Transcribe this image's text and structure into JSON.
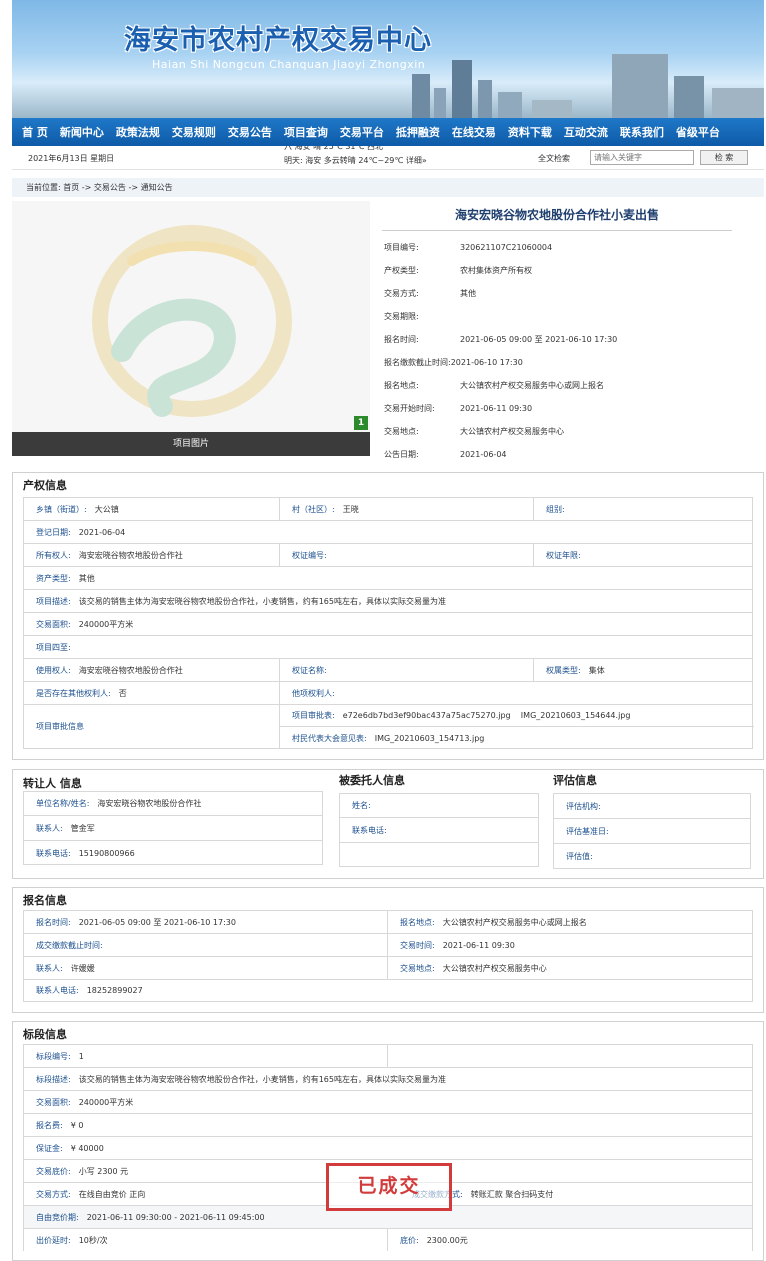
{
  "header": {
    "title": "海安市农村产权交易中心",
    "subtitle": "Haian Shi Nongcun Chanquan Jiaoyi Zhongxin"
  },
  "nav": [
    "首 页",
    "新闻中心",
    "政策法规",
    "交易规则",
    "交易公告",
    "项目查询",
    "交易平台",
    "抵押融资",
    "在线交易",
    "资料下载",
    "互动交流",
    "联系我们",
    "省级平台"
  ],
  "infobar": {
    "date": "2021年6月13日 星期日",
    "weather_top": "六 海安 晴 25℃ 31℃ 西北",
    "weather_bottom": "明天: 海安 多云转晴 24℃~29℃ 详细»",
    "search_label": "全文检索",
    "search_placeholder": "请输入关键字",
    "search_button": "检 索"
  },
  "breadcrumb": "当前位置: 首页 -> 交易公告 -> 通知公告",
  "project": {
    "title": "海安宏晓谷物农地股份合作社小麦出售",
    "image_caption": "项目图片",
    "image_index": "1",
    "fields": [
      [
        "项目编号:",
        "320621107C21060004"
      ],
      [
        "产权类型:",
        "农村集体资产所有权"
      ],
      [
        "交易方式:",
        "其他"
      ],
      [
        "交易期限:",
        ""
      ],
      [
        "报名时间:",
        "2021-06-05 09:00 至 2021-06-10 17:30"
      ],
      [
        "报名缴款截止时间:",
        "2021-06-10 17:30"
      ],
      [
        "报名地点:",
        "大公镇农村产权交易服务中心或网上报名"
      ],
      [
        "交易开始时间:",
        "2021-06-11 09:30"
      ],
      [
        "交易地点:",
        "大公镇农村产权交易服务中心"
      ],
      [
        "公告日期:",
        "2021-06-04"
      ]
    ]
  },
  "property": {
    "title": "产权信息",
    "town_l": "乡镇（街道）:",
    "town": "大公镇",
    "village_l": "村（社区）:",
    "village": "王晓",
    "group_l": "组别:",
    "group": "",
    "regdate_l": "登记日期:",
    "regdate": "2021-06-04",
    "owner_l": "所有权人:",
    "owner": "海安宏晓谷物农地股份合作社",
    "cert_l": "权证编号:",
    "cert": "",
    "certyear_l": "权证年限:",
    "certyear": "",
    "assettype_l": "资产类型:",
    "assettype": "其他",
    "desc_l": "项目描述:",
    "desc": "该交易的销售主体为海安宏晓谷物农地股份合作社，小麦销售，约有165吨左右，具体以实际交易量为准",
    "area_l": "交易面积:",
    "area": "240000平方米",
    "bound_l": "项目四至:",
    "bound": "",
    "user_l": "使用权人:",
    "user": "海安宏晓谷物农地股份合作社",
    "certname_l": "权证名称:",
    "certname": "",
    "owntype_l": "权属类型:",
    "owntype": "集体",
    "other_l": "是否存在其他权利人:",
    "other": "否",
    "otherperson_l": "他项权利人:",
    "otherperson": "",
    "approve_l": "项目审批信息",
    "approvedoc_l": "项目审批表:",
    "approvedoc": "e72e6db7bd3ef90bac437a75ac75270.jpg    IMG_20210603_154644.jpg",
    "villagerep_l": "村民代表大会意见表:",
    "villagerep": "IMG_20210603_154713.jpg"
  },
  "parties": {
    "transfer_title": "转让人 信息",
    "unit_l": "单位名称/姓名:",
    "unit": "海安宏晓谷物农地股份合作社",
    "contact_l": "联系人:",
    "contact": "管金军",
    "phone_l": "联系电话:",
    "phone": "15190800966",
    "entrust_title": "被委托人信息",
    "ename_l": "姓名:",
    "ename": "",
    "ephone_l": "联系电话:",
    "ephone": "",
    "eval_title": "评估信息",
    "eorg_l": "评估机构:",
    "eorg": "",
    "ebase_l": "评估基准日:",
    "ebase": "",
    "evalue_l": "评估值:",
    "evalue": ""
  },
  "signup": {
    "title": "报名信息",
    "time_l": "报名时间:",
    "time": "2021-06-05 09:00 至 2021-06-10 17:30",
    "place_l": "报名地点:",
    "place": "大公镇农村产权交易服务中心或网上报名",
    "deadline_l": "成交缴款截止时间:",
    "deadline": "",
    "trtime_l": "交易时间:",
    "trtime": "2021-06-11 09:30",
    "contact_l": "联系人:",
    "contact": "许媛媛",
    "trplace_l": "交易地点:",
    "trplace": "大公镇农村产权交易服务中心",
    "phone_l": "联系人电话:",
    "phone": "18252899027"
  },
  "lot": {
    "title": "标段信息",
    "no_l": "标段编号:",
    "no": "1",
    "desc_l": "标段描述:",
    "desc": "该交易的销售主体为海安宏晓谷物农地股份合作社，小麦销售，约有165吨左右，具体以实际交易量为准",
    "area_l": "交易面积:",
    "area": "240000平方米",
    "fee_l": "报名费:",
    "fee": "¥ 0",
    "deposit_l": "保证金:",
    "deposit": "¥ 40000",
    "reserve_l": "交易底价:",
    "reserve": "小写 2300 元",
    "method_l": "交易方式:",
    "method": "在线自由竞价 正向",
    "pay_l": "成交缴款方式:",
    "pay": "转账汇款 聚合扫码支付",
    "bidtime_l": "自由竞价期:",
    "bidtime": "2021-06-11 09:30:00 - 2021-06-11 09:45:00",
    "delay_l": "出价延时:",
    "delay": "10秒/次",
    "base_l": "底价:",
    "base": "2300.00元"
  },
  "stamp": "已成交"
}
